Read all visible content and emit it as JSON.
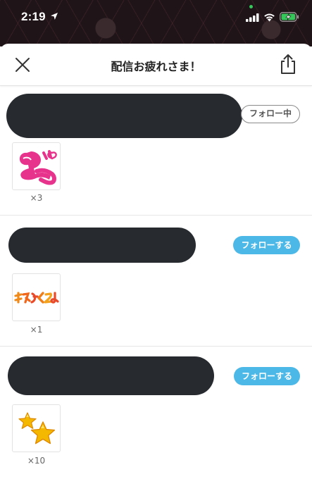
{
  "status_bar": {
    "time": "2:19"
  },
  "header": {
    "title": "配信お疲れさま！"
  },
  "gifters": [
    {
      "follow_label": "フォロー中",
      "follow_state": "following",
      "gift_name": "ぎょぴ",
      "count": "×3"
    },
    {
      "follow_label": "フォローする",
      "follow_state": "not-following",
      "gift_name": "またくるよ",
      "count": "×1"
    },
    {
      "follow_label": "フォローする",
      "follow_state": "not-following",
      "gift_name": "stars-icon",
      "count": "×10"
    }
  ],
  "colors": {
    "follow_active": "#4cb8e8",
    "redaction": "#272b30"
  }
}
